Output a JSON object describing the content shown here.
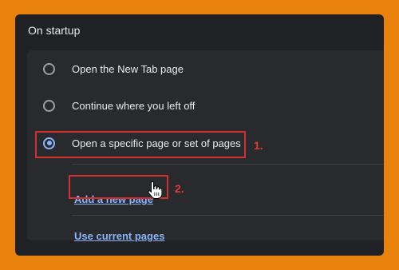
{
  "settings": {
    "section_title": "On startup",
    "options": [
      {
        "label": "Open the New Tab page",
        "selected": false
      },
      {
        "label": "Continue where you left off",
        "selected": false
      },
      {
        "label": "Open a specific page or set of pages",
        "selected": true
      }
    ],
    "links": {
      "add_page": "Add a new page",
      "use_current": "Use current pages"
    }
  },
  "annotations": {
    "step1": "1.",
    "step2": "2."
  },
  "colors": {
    "background": "#E8820C",
    "panel": "#202124",
    "card": "#292A2D",
    "accent": "#8AB4F8",
    "annotation": "#D32F2F"
  },
  "icons": {
    "cursor": "hand-pointer-icon"
  }
}
